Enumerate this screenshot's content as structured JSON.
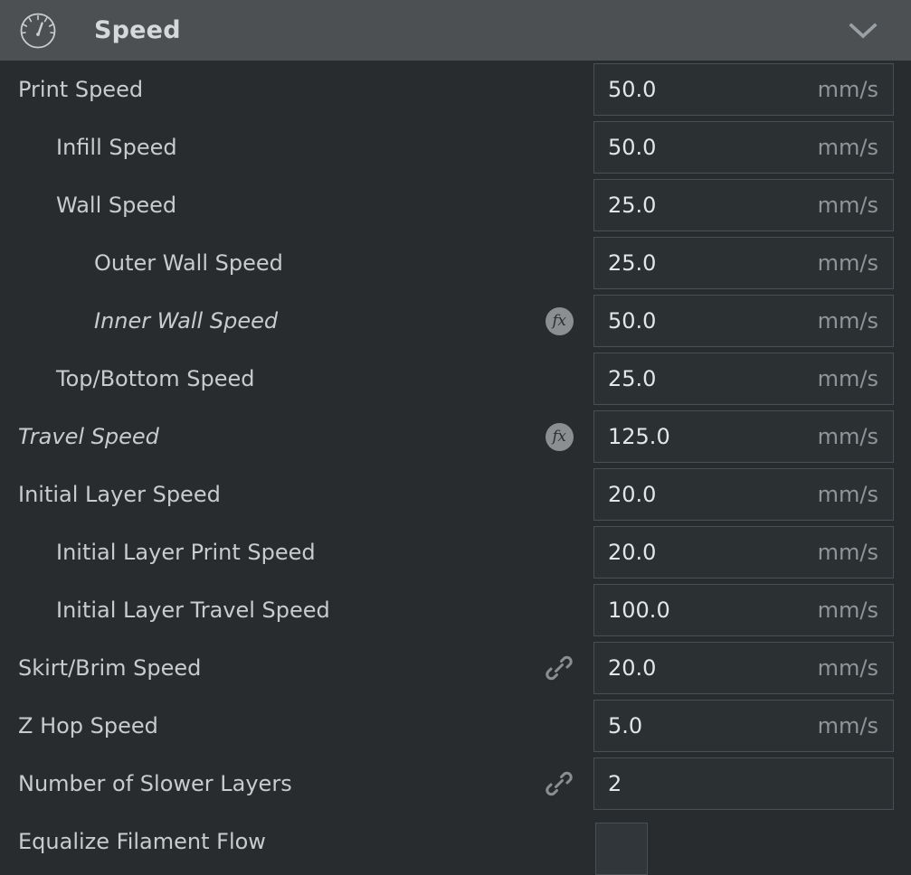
{
  "header": {
    "title": "Speed",
    "icon": "speedometer-icon",
    "collapse_icon": "chevron-down-icon",
    "background_color": "#4c5053",
    "title_color": "#d6d9da"
  },
  "theme": {
    "panel_background": "#282c2f",
    "field_background": "#2b3033",
    "field_border": "#4a4f53",
    "label_color": "#c8ccce",
    "value_color": "#e3e6e7",
    "unit_color": "#8f9598",
    "badge_color": "#8b8f92"
  },
  "settings": [
    {
      "label": "Print Speed",
      "indent": 0,
      "italic": false,
      "badge": "none",
      "control": "text",
      "value": "50.0",
      "unit": "mm/s"
    },
    {
      "label": "Infill Speed",
      "indent": 1,
      "italic": false,
      "badge": "none",
      "control": "text",
      "value": "50.0",
      "unit": "mm/s"
    },
    {
      "label": "Wall Speed",
      "indent": 1,
      "italic": false,
      "badge": "none",
      "control": "text",
      "value": "25.0",
      "unit": "mm/s"
    },
    {
      "label": "Outer Wall Speed",
      "indent": 2,
      "italic": false,
      "badge": "none",
      "control": "text",
      "value": "25.0",
      "unit": "mm/s"
    },
    {
      "label": "Inner Wall Speed",
      "indent": 2,
      "italic": true,
      "badge": "fx",
      "badge_text": "fx",
      "control": "text",
      "value": "50.0",
      "unit": "mm/s"
    },
    {
      "label": "Top/Bottom Speed",
      "indent": 1,
      "italic": false,
      "badge": "none",
      "control": "text",
      "value": "25.0",
      "unit": "mm/s"
    },
    {
      "label": "Travel Speed",
      "indent": 0,
      "italic": true,
      "badge": "fx",
      "badge_text": "fx",
      "control": "text",
      "value": "125.0",
      "unit": "mm/s"
    },
    {
      "label": "Initial Layer Speed",
      "indent": 0,
      "italic": false,
      "badge": "none",
      "control": "text",
      "value": "20.0",
      "unit": "mm/s"
    },
    {
      "label": "Initial Layer Print Speed",
      "indent": 1,
      "italic": false,
      "badge": "none",
      "control": "text",
      "value": "20.0",
      "unit": "mm/s"
    },
    {
      "label": "Initial Layer Travel Speed",
      "indent": 1,
      "italic": false,
      "badge": "none",
      "control": "text",
      "value": "100.0",
      "unit": "mm/s"
    },
    {
      "label": "Skirt/Brim Speed",
      "indent": 0,
      "italic": false,
      "badge": "link",
      "control": "text",
      "value": "20.0",
      "unit": "mm/s"
    },
    {
      "label": "Z Hop Speed",
      "indent": 0,
      "italic": false,
      "badge": "none",
      "control": "text",
      "value": "5.0",
      "unit": "mm/s"
    },
    {
      "label": "Number of Slower Layers",
      "indent": 0,
      "italic": false,
      "badge": "link",
      "control": "text",
      "value": "2",
      "unit": ""
    },
    {
      "label": "Equalize Filament Flow",
      "indent": 0,
      "italic": false,
      "badge": "none",
      "control": "checkbox",
      "checked": false,
      "value": "",
      "unit": ""
    }
  ]
}
